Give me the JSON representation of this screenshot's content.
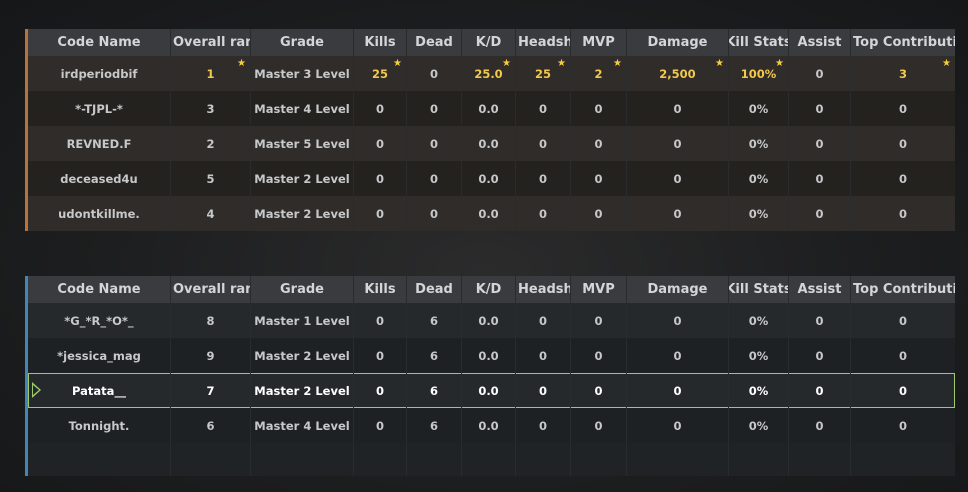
{
  "headers": [
    "Code Name",
    "Overall rank",
    "Grade",
    "Kills",
    "Dead",
    "K/D",
    "Headshot",
    "MVP",
    "Damage",
    "Kill Stats",
    "Assist",
    "Top Contribution"
  ],
  "team_top": {
    "accent_color": "#b9733a",
    "rows": [
      {
        "cells": [
          "irdperiodbif",
          "1",
          "Master 3 Level",
          "25",
          "0",
          "25.0",
          "25",
          "2",
          "2,500",
          "100%",
          "0",
          "3"
        ],
        "highlight": true
      },
      {
        "cells": [
          "*-TJPL-*",
          "3",
          "Master 4 Level",
          "0",
          "0",
          "0.0",
          "0",
          "0",
          "0",
          "0%",
          "0",
          "0"
        ]
      },
      {
        "cells": [
          "REVNED.F",
          "2",
          "Master 5 Level",
          "0",
          "0",
          "0.0",
          "0",
          "0",
          "0",
          "0%",
          "0",
          "0"
        ]
      },
      {
        "cells": [
          "deceased4u",
          "5",
          "Master 2 Level",
          "0",
          "0",
          "0.0",
          "0",
          "0",
          "0",
          "0%",
          "0",
          "0"
        ]
      },
      {
        "cells": [
          "udontkillme.",
          "4",
          "Master 2 Level",
          "0",
          "0",
          "0.0",
          "0",
          "0",
          "0",
          "0%",
          "0",
          "0"
        ]
      }
    ]
  },
  "team_bottom": {
    "accent_color": "#3f87b8",
    "rows": [
      {
        "cells": [
          "*G_*R_*O*_",
          "8",
          "Master 1 Level",
          "0",
          "6",
          "0.0",
          "0",
          "0",
          "0",
          "0%",
          "0",
          "0"
        ]
      },
      {
        "cells": [
          "*jessica_mag",
          "9",
          "Master 2 Level",
          "0",
          "6",
          "0.0",
          "0",
          "0",
          "0",
          "0%",
          "0",
          "0"
        ]
      },
      {
        "cells": [
          "Patata__",
          "7",
          "Master 2 Level",
          "0",
          "6",
          "0.0",
          "0",
          "0",
          "0",
          "0%",
          "0",
          "0"
        ],
        "current_player": true
      },
      {
        "cells": [
          "Tonnight.",
          "6",
          "Master 4 Level",
          "0",
          "6",
          "0.0",
          "0",
          "0",
          "0",
          "0%",
          "0",
          "0"
        ]
      }
    ]
  },
  "star_glyph": "★",
  "colors": {
    "gold": "#f2c94c",
    "self_outline": "#9ec86b"
  }
}
